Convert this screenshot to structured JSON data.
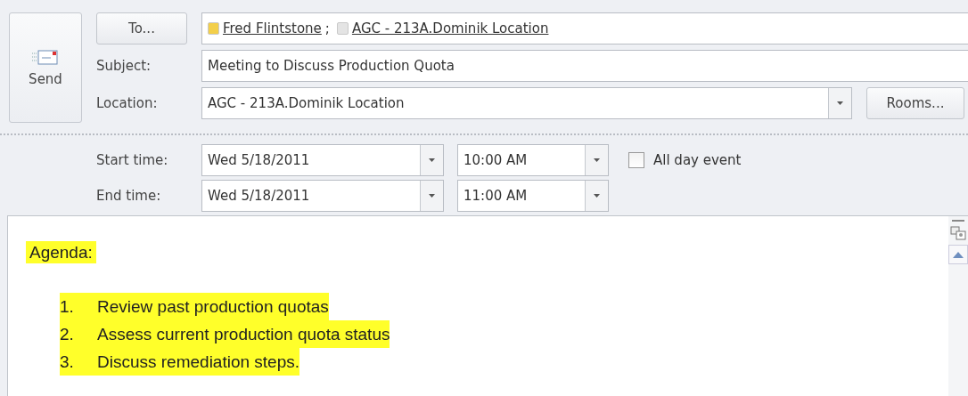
{
  "send_button": {
    "label": "Send"
  },
  "to_button": {
    "label": "To..."
  },
  "recipients": [
    {
      "name": "Fred Flintstone",
      "separator": ";",
      "color": "#f3cf4a"
    },
    {
      "name": "AGC - 213A.Dominik Location",
      "color": "#e4e4e4"
    }
  ],
  "subject": {
    "label": "Subject:",
    "value": "Meeting to Discuss Production Quota"
  },
  "location": {
    "label": "Location:",
    "value": "AGC - 213A.Dominik Location"
  },
  "rooms_button": {
    "label": "Rooms..."
  },
  "times": [
    {
      "label": "Start time:",
      "date": "Wed 5/18/2011",
      "time": "10:00 AM"
    },
    {
      "label": "End time:",
      "date": "Wed 5/18/2011",
      "time": "11:00 AM"
    }
  ],
  "all_day_event": {
    "label": "All day event",
    "checked": false
  },
  "body": {
    "heading": {
      "text": "Agenda:",
      "highlighted": true
    },
    "items": [
      {
        "number": "1.",
        "text": "Review past production quotas",
        "highlighted": true
      },
      {
        "number": "2.",
        "text": "Assess current production quota status",
        "highlighted": true
      },
      {
        "number": "3.",
        "text": "Discuss remediation steps.",
        "highlighted": true
      }
    ]
  }
}
